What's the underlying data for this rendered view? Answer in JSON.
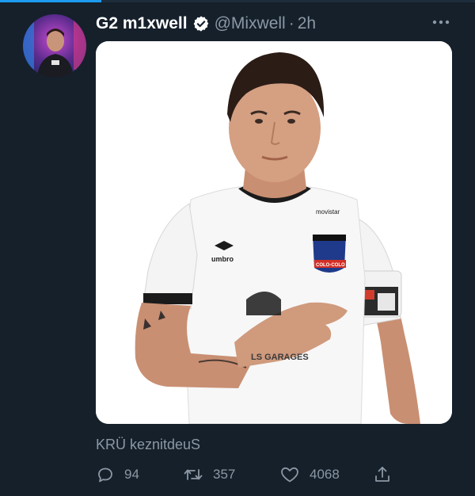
{
  "tweet": {
    "author": {
      "display_name": "G2 m1xwell",
      "handle": "@Mixwell",
      "verified": true
    },
    "separator": "·",
    "time": "2h",
    "text": "KRÜ keznitdeuS",
    "media": {
      "jersey_logo": "umbro",
      "sponsor": "movistar",
      "badge_text": "COLO-COLO",
      "jersey_text": "LS GARAGES"
    },
    "actions": {
      "replies": "94",
      "retweets": "357",
      "likes": "4068"
    }
  },
  "icons": {
    "more": "more-horizontal-icon",
    "verified": "verified-badge-icon",
    "reply": "reply-icon",
    "retweet": "retweet-icon",
    "like": "heart-icon",
    "share": "share-icon"
  },
  "colors": {
    "background": "#15202b",
    "secondary_text": "#8b98a5",
    "accent": "#1d9bf0"
  }
}
